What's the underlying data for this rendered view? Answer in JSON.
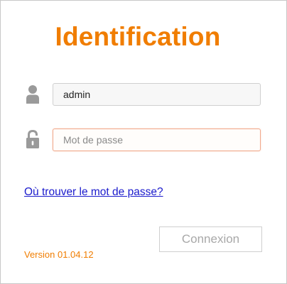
{
  "header": {
    "title": "Identification"
  },
  "form": {
    "username": {
      "icon": "user-icon",
      "value": "admin"
    },
    "password": {
      "icon": "lock-icon",
      "value": "",
      "placeholder": "Mot de passe"
    }
  },
  "help": {
    "link_label": "Où trouver le mot de passe?"
  },
  "actions": {
    "connect_label": "Connexion"
  },
  "footer": {
    "version": "Version 01.04.12"
  },
  "colors": {
    "accent": "#f07d00",
    "link": "#1a1acc",
    "icon": "#9a9a9a"
  }
}
